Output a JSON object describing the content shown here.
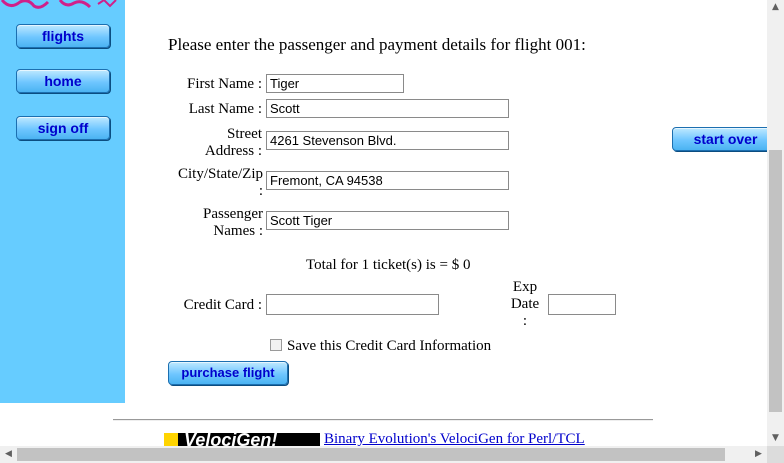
{
  "nav": {
    "flights": "flights",
    "home": "home",
    "sign_off": "sign off",
    "start_over": "start over"
  },
  "form": {
    "intro": "Please enter the passenger and payment details for flight 001:",
    "first_name_label": "First Name :",
    "first_name_value": "Tiger",
    "last_name_label": "Last Name :",
    "last_name_value": "Scott",
    "street_label_1": "Street",
    "street_label_2": "Address :",
    "street_value": "4261 Stevenson Blvd.",
    "city_label_1": "City/State/Zip",
    "city_label_2": ":",
    "city_value": "Fremont, CA 94538",
    "passenger_label_1": "Passenger",
    "passenger_label_2": "Names :",
    "passenger_value": "Scott Tiger",
    "total": "Total for 1 ticket(s) is = $ 0",
    "credit_card_label": "Credit Card :",
    "credit_card_value": "",
    "exp_label_1": "Exp",
    "exp_label_2": "Date",
    "exp_label_3": ":",
    "exp_value": "",
    "save_cc_label": "Save this Credit Card Information",
    "save_cc_checked": false,
    "purchase_label": "purchase flight"
  },
  "footer": {
    "logo_text": "VelociGen!",
    "link_text": "Binary Evolution's VelociGen for Perl/TCL"
  },
  "colors": {
    "sidebar": "#66ccff",
    "link": "#0000cc",
    "button_text": "#0000cc"
  }
}
